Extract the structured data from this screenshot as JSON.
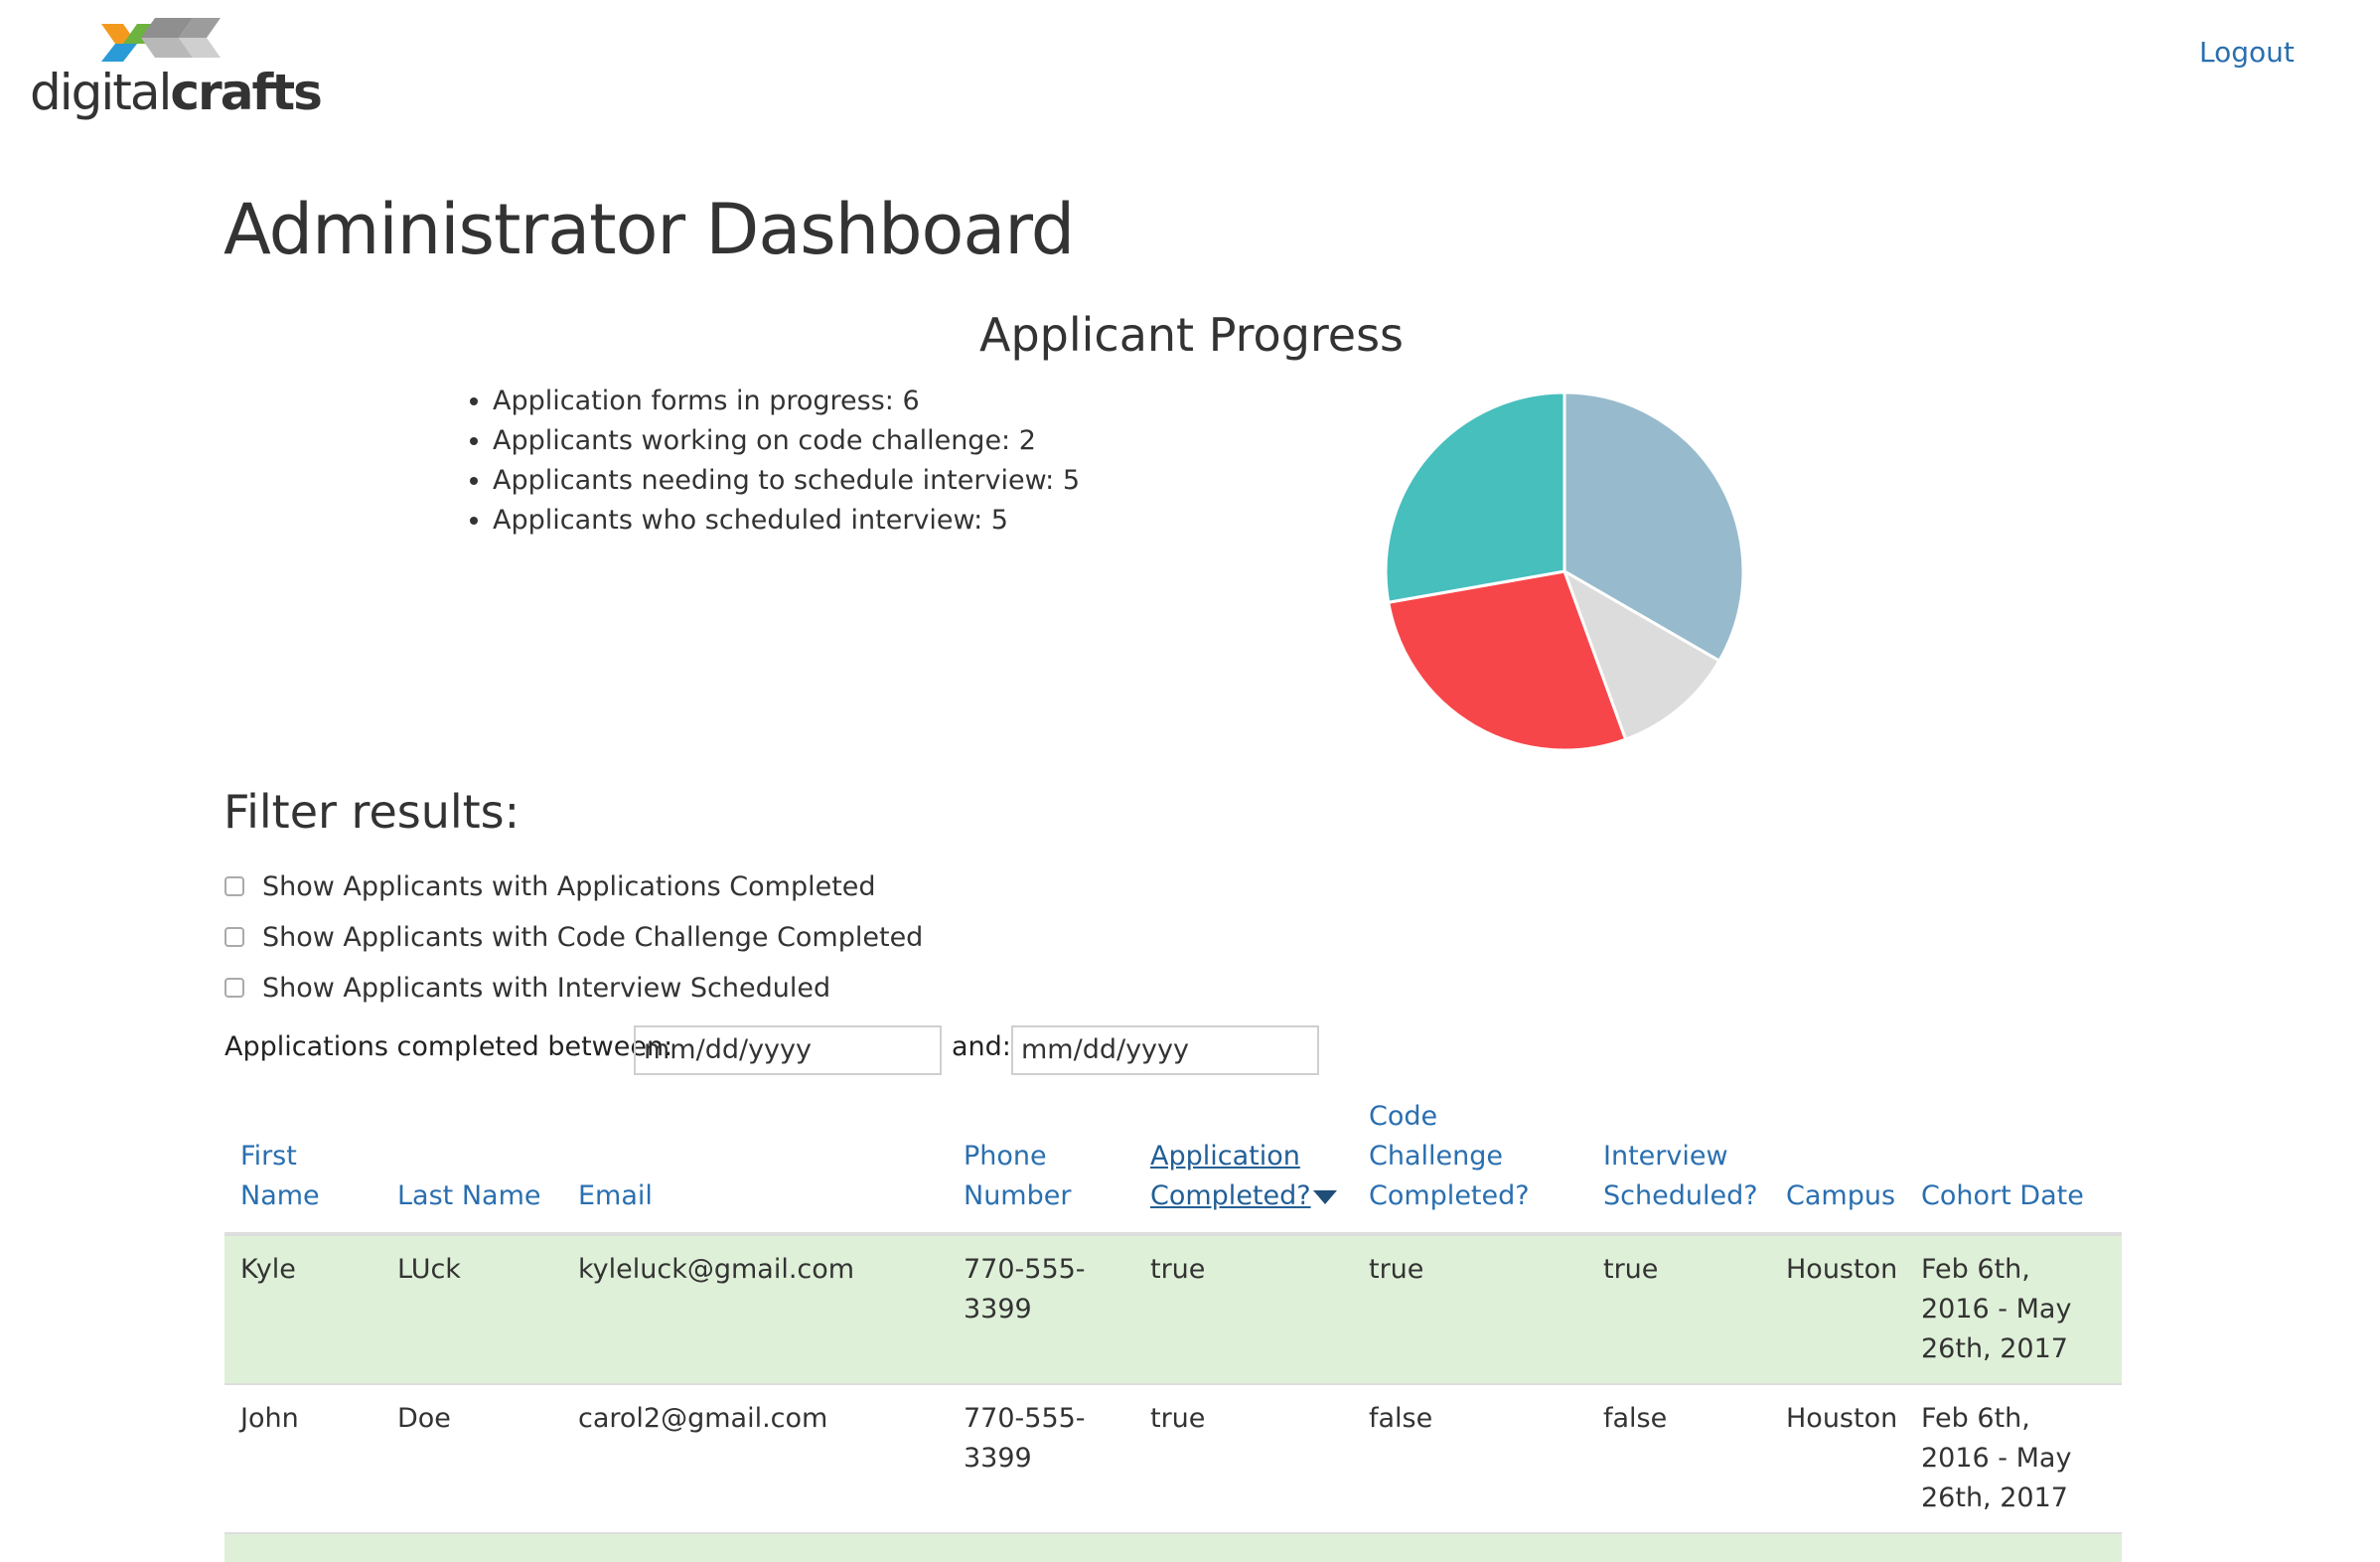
{
  "header": {
    "logo_text_light": "digital",
    "logo_text_bold": "crafts",
    "logout_label": "Logout"
  },
  "page": {
    "title": "Administrator Dashboard"
  },
  "progress": {
    "title": "Applicant Progress",
    "stats": [
      "Application forms in progress: 6",
      "Applicants working on code challenge: 2",
      "Applicants needing to schedule interview: 5",
      "Applicants who scheduled interview: 5"
    ],
    "pie": {
      "slices": [
        {
          "value": 6,
          "color": "#97bbcd"
        },
        {
          "value": 2,
          "color": "#dcdcdc"
        },
        {
          "value": 5,
          "color": "#f7464a"
        },
        {
          "value": 5,
          "color": "#46bfbd"
        }
      ]
    }
  },
  "filters": {
    "title": "Filter results:",
    "checkboxes": [
      "Show Applicants with Applications Completed",
      "Show Applicants with Code Challenge Completed",
      "Show Applicants with Interview Scheduled"
    ],
    "date_range": {
      "label_between": "Applications completed between:",
      "label_and": "and:",
      "start_placeholder": "mm/dd/yyyy",
      "end_placeholder": "mm/dd/yyyy"
    }
  },
  "table": {
    "headers": [
      "First Name",
      "Last Name",
      "Email",
      "Phone Number",
      "Application Completed?",
      "Code Challenge Completed?",
      "Interview Scheduled?",
      "Campus",
      "Cohort Date"
    ],
    "rows": [
      [
        "Kyle",
        "LUck",
        "kyleluck@gmail.com",
        "770-555-3399",
        "true",
        "true",
        "true",
        "Houston",
        "Feb 6th, 2016 - May 26th, 2017"
      ],
      [
        "John",
        "Doe",
        "carol2@gmail.com",
        "770-555-3399",
        "true",
        "false",
        "false",
        "Houston",
        "Feb 6th, 2016 - May 26th, 2017"
      ]
    ]
  },
  "colors": {
    "link": "#2a6fb0",
    "row_success": "#dff0d8"
  }
}
